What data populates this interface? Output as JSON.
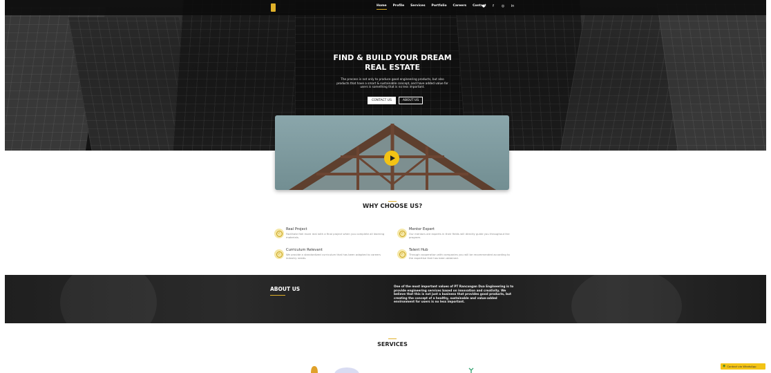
{
  "header": {
    "logo_text": "",
    "nav": [
      "Home",
      "Profile",
      "Services",
      "Portfolio",
      "Careers",
      "Contact"
    ],
    "active_nav": "Home",
    "socials": [
      "twitter-icon",
      "facebook-icon",
      "instagram-icon",
      "linkedin-icon"
    ]
  },
  "hero": {
    "title_line1": "FIND & BUILD YOUR DREAM",
    "title_line2": "REAL ESTATE",
    "description": "The process is not only to produce good engineering products, but also products that have a smart & sustainable concept, and have added value for users is something that is no less important.",
    "btn_contact": "CONTACT US",
    "btn_about": "ABOUT US"
  },
  "why": {
    "title": "WHY CHOOSE US?",
    "features": [
      {
        "title": "Real Project",
        "desc": "Facilitate feel more real with a final project when you complete all learning materials."
      },
      {
        "title": "Mentor Expert",
        "desc": "Our mentors are experts in their fields will directly guide you throughout the program."
      },
      {
        "title": "Curriculum Relevant",
        "desc": "We provide a standardized curriculum that has been adapted to careers industry needs."
      },
      {
        "title": "Talent Hub",
        "desc": "Through cooperation with companies you will be recommended according to the expertise that has been obtained."
      }
    ]
  },
  "about": {
    "title": "ABOUT US",
    "text": "One of the most important values of PT Rancangan Dua Engineering is to provide engineering services based on innovation and creativity. We believe that this is not just a business that provides good products, but creating the concept of a healthy, sustainable and value-added environment for users is no less important."
  },
  "services": {
    "title": "SERVICES"
  },
  "whatsapp": {
    "label": "Contact via WhatsApp"
  },
  "colors": {
    "accent": "#f3c315",
    "dark": "#1e1e1e"
  }
}
